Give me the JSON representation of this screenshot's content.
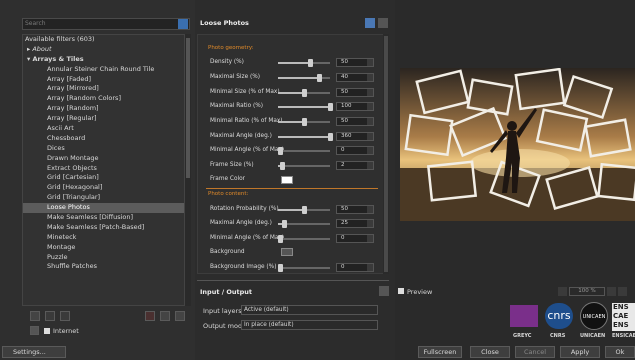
{
  "left": {
    "search_placeholder": "Search",
    "filters": [
      {
        "label": "Available filters (603)",
        "level": 0
      },
      {
        "label": "▸  About",
        "level": 1,
        "italic": true
      },
      {
        "label": "▾  Arrays & Tiles",
        "level": 1,
        "bold": true
      },
      {
        "label": "Annular Steiner Chain Round Tile",
        "level": 2
      },
      {
        "label": "Array [Faded]",
        "level": 2
      },
      {
        "label": "Array [Mirrored]",
        "level": 2
      },
      {
        "label": "Array [Random Colors]",
        "level": 2
      },
      {
        "label": "Array [Random]",
        "level": 2
      },
      {
        "label": "Array [Regular]",
        "level": 2
      },
      {
        "label": "Ascii Art",
        "level": 2
      },
      {
        "label": "Chessboard",
        "level": 2
      },
      {
        "label": "Dices",
        "level": 2
      },
      {
        "label": "Drawn Montage",
        "level": 2
      },
      {
        "label": "Extract Objects",
        "level": 2
      },
      {
        "label": "Grid [Cartesian]",
        "level": 2
      },
      {
        "label": "Grid [Hexagonal]",
        "level": 2
      },
      {
        "label": "Grid [Triangular]",
        "level": 2
      },
      {
        "label": "Loose Photos",
        "level": 2,
        "selected": true
      },
      {
        "label": "Make Seamless [Diffusion]",
        "level": 2
      },
      {
        "label": "Make Seamless [Patch-Based]",
        "level": 2
      },
      {
        "label": "Mineteck",
        "level": 2
      },
      {
        "label": "Montage",
        "level": 2
      },
      {
        "label": "Puzzle",
        "level": 2
      },
      {
        "label": "Shuffle Patches",
        "level": 2
      }
    ],
    "internet_label": "Internet",
    "settings_label": "Settings..."
  },
  "center": {
    "title": "Loose Photos",
    "photo_geometry_header": "Photo geometry:",
    "photo_content_header": "Photo content:",
    "params": [
      {
        "label": "Density (%)",
        "value": "50",
        "frac": 0.62
      },
      {
        "label": "Maximal Size (%)",
        "value": "40",
        "frac": 0.8
      },
      {
        "label": "Minimal Size (% of Max)",
        "value": "50",
        "frac": 0.5
      },
      {
        "label": "Maximal Ratio (%)",
        "value": "100",
        "frac": 1.0
      },
      {
        "label": "Minimal Ratio (% of Max)",
        "value": "50",
        "frac": 0.5
      },
      {
        "label": "Maximal Angle (deg.)",
        "value": "360",
        "frac": 1.0
      },
      {
        "label": "Minimal Angle (% of Max)",
        "value": "0",
        "frac": 0.0
      },
      {
        "label": "Frame Size (%)",
        "value": "2",
        "frac": 0.08
      },
      {
        "label": "Rotation Probability (%)",
        "value": "50",
        "frac": 0.5
      },
      {
        "label": "Maximal Angle (deg.)",
        "value": "25",
        "frac": 0.12
      },
      {
        "label": "Minimal Angle (% of Max)",
        "value": "0",
        "frac": 0.0
      },
      {
        "label": "Background Image (%)",
        "value": "0",
        "frac": 0.0
      }
    ],
    "frame_color_label": "Frame Color",
    "background_label": "Background",
    "io_title": "Input / Output",
    "input_layers_label": "Input layers",
    "input_layers_value": "Active (default)",
    "output_mode_label": "Output mode",
    "output_mode_value": "In place (default)"
  },
  "right": {
    "preview_label": "Preview",
    "zoom": "100 %",
    "logos": [
      "GREYC",
      "CNRS",
      "UNICAEN",
      "ENSICAEN"
    ],
    "fullscreen": "Fullscreen",
    "close": "Close",
    "cancel": "Cancel",
    "apply": "Apply",
    "ok": "Ok"
  },
  "colors": {
    "accent": "#e08a2a",
    "selection": "#5c5c5c",
    "bg": "#2b2b2b"
  }
}
